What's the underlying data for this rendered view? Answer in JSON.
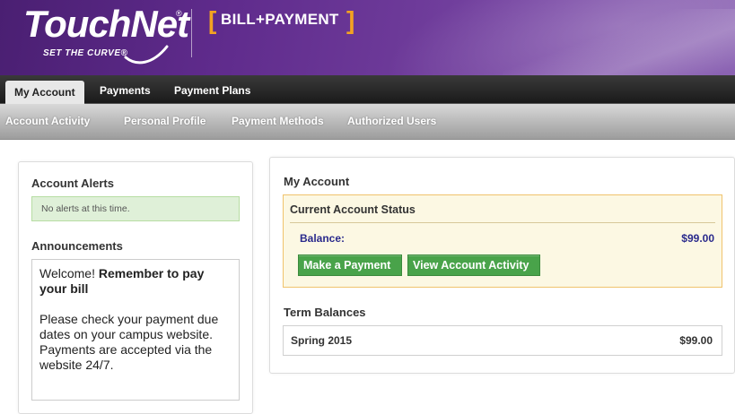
{
  "header": {
    "logo_text": "TouchNet",
    "logo_registered": "®",
    "tagline": "SET THE CURVE®",
    "product_name": "BILL+PAYMENT",
    "bracket_left": "[",
    "bracket_right": "]",
    "colors": {
      "purple": "#5f2b8c",
      "accent": "#f3a321"
    }
  },
  "nav_primary": {
    "tabs": [
      {
        "label": "My Account",
        "active": true
      },
      {
        "label": "Payments",
        "active": false
      },
      {
        "label": "Payment Plans",
        "active": false
      }
    ]
  },
  "nav_secondary": {
    "items": [
      {
        "label": "Account Activity"
      },
      {
        "label": "Personal Profile"
      },
      {
        "label": "Payment Methods"
      },
      {
        "label": "Authorized Users"
      }
    ]
  },
  "left_panel": {
    "alerts_title": "Account Alerts",
    "alerts_message": "No alerts at this time.",
    "announcements_title": "Announcements",
    "announcement_lead": "Welcome! ",
    "announcement_bold": "Remember to pay your bill",
    "announcement_body": "Please check your payment due dates on your campus website. Payments are accepted via the website 24/7."
  },
  "right_panel": {
    "title": "My Account",
    "status_title": "Current Account Status",
    "balance_label": "Balance:",
    "balance_value": "$99.00",
    "make_payment_label": "Make a Payment",
    "view_activity_label": "View Account Activity",
    "term_balances_title": "Term Balances",
    "terms": [
      {
        "name": "Spring 2015",
        "amount": "$99.00"
      }
    ],
    "colors": {
      "button_green": "#49a34a",
      "status_bg": "#fcf8e3",
      "link_blue": "#2a2a8c"
    }
  }
}
